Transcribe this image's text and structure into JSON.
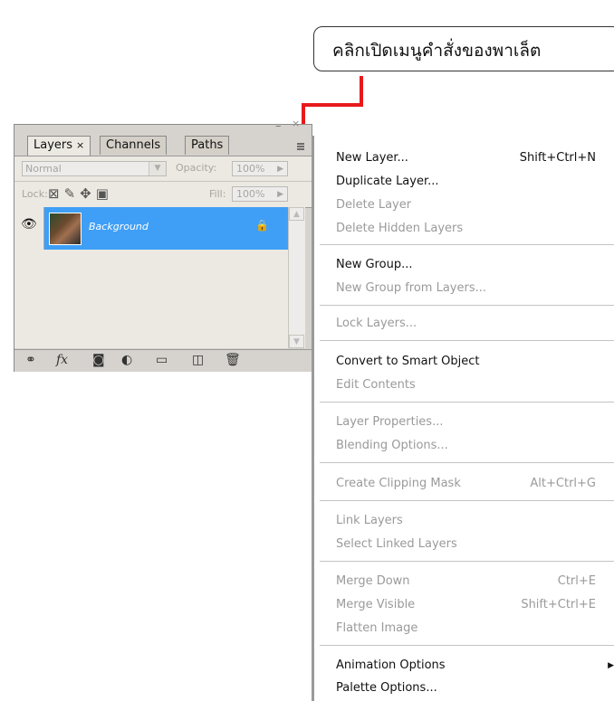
{
  "callout": {
    "text": "คลิกเปิดเมนูคำสั่งของพาเล็ต"
  },
  "panel": {
    "tabs": [
      {
        "label": "Layers",
        "close": "×"
      },
      {
        "label": "Channels"
      },
      {
        "label": "Paths"
      }
    ],
    "blend_mode": "Normal",
    "opacity_label": "Opacity:",
    "opacity_value": "100%",
    "lock_label": "Lock:",
    "fill_label": "Fill:",
    "fill_value": "100%",
    "layer": {
      "name": "Background"
    }
  },
  "menu": {
    "items": [
      {
        "label": "New Layer...",
        "shortcut": "Shift+Ctrl+N",
        "enabled": true
      },
      {
        "label": "Duplicate Layer...",
        "enabled": true
      },
      {
        "label": "Delete Layer",
        "enabled": false
      },
      {
        "label": "Delete Hidden Layers",
        "enabled": false
      },
      {
        "label": "New Group...",
        "enabled": true
      },
      {
        "label": "New Group from Layers...",
        "enabled": false
      },
      {
        "label": "Lock Layers...",
        "enabled": false
      },
      {
        "label": "Convert to Smart Object",
        "enabled": true
      },
      {
        "label": "Edit Contents",
        "enabled": false
      },
      {
        "label": "Layer Properties...",
        "enabled": false
      },
      {
        "label": "Blending Options...",
        "enabled": false
      },
      {
        "label": "Create Clipping Mask",
        "shortcut": "Alt+Ctrl+G",
        "enabled": false
      },
      {
        "label": "Link Layers",
        "enabled": false
      },
      {
        "label": "Select Linked Layers",
        "enabled": false
      },
      {
        "label": "Merge Down",
        "shortcut": "Ctrl+E",
        "enabled": false
      },
      {
        "label": "Merge Visible",
        "shortcut": "Shift+Ctrl+E",
        "enabled": false
      },
      {
        "label": "Flatten Image",
        "enabled": false
      },
      {
        "label": "Animation Options",
        "enabled": true
      },
      {
        "label": "Palette Options...",
        "enabled": true
      }
    ]
  },
  "colors": {
    "accent_red": "#e8191b",
    "selected_layer": "#3f9ff7"
  }
}
